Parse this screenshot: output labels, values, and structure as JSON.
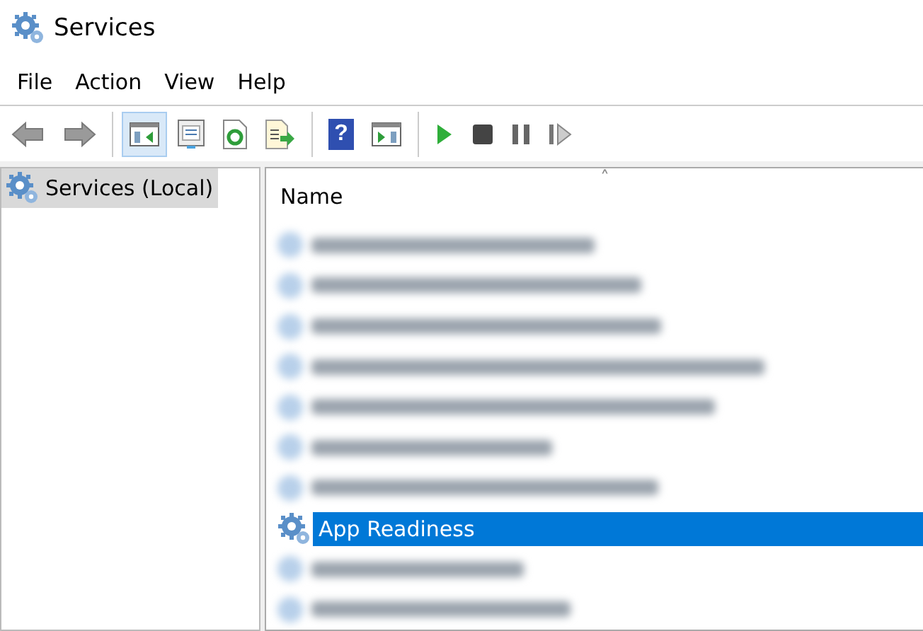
{
  "window": {
    "title": "Services"
  },
  "menu": [
    "File",
    "Action",
    "View",
    "Help"
  ],
  "toolbar": [
    {
      "kind": "back",
      "active": false
    },
    {
      "kind": "forward",
      "active": false
    },
    {
      "kind": "separator"
    },
    {
      "kind": "console-tree",
      "active": true
    },
    {
      "kind": "properties",
      "active": false
    },
    {
      "kind": "refresh",
      "active": false
    },
    {
      "kind": "export",
      "active": false
    },
    {
      "kind": "separator"
    },
    {
      "kind": "help",
      "glyph": "?",
      "active": false
    },
    {
      "kind": "action-pane",
      "active": false
    },
    {
      "kind": "separator"
    },
    {
      "kind": "start",
      "active": false
    },
    {
      "kind": "stop",
      "active": false
    },
    {
      "kind": "pause",
      "active": false
    },
    {
      "kind": "resume",
      "active": false
    }
  ],
  "tree": {
    "items": [
      {
        "label": "Services (Local)",
        "selected": true
      }
    ]
  },
  "table": {
    "columns": [
      {
        "label": "Name",
        "sort_indicator": "˄"
      }
    ],
    "rows": [
      {
        "kind": "blurred",
        "selected": false
      },
      {
        "kind": "blurred",
        "selected": false
      },
      {
        "kind": "blurred",
        "selected": false
      },
      {
        "kind": "blurred",
        "selected": false
      },
      {
        "kind": "blurred",
        "selected": false
      },
      {
        "kind": "blurred",
        "selected": false
      },
      {
        "kind": "blurred",
        "selected": false
      },
      {
        "kind": "service",
        "name": "App Readiness",
        "selected": true
      },
      {
        "kind": "blurred",
        "selected": false
      },
      {
        "kind": "blurred",
        "selected": false
      }
    ]
  }
}
